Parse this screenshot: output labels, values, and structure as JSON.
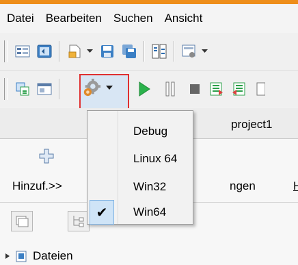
{
  "menubar": {
    "items": [
      "Datei",
      "Bearbeiten",
      "Suchen",
      "Ansicht"
    ]
  },
  "toolbar1": {
    "icons": [
      "properties-icon",
      "project-icon",
      "new-file-icon",
      "save-icon",
      "save-all-icon",
      "compare-icon",
      "options-icon"
    ]
  },
  "toolbar2": {
    "icons": [
      "copy-icon",
      "window-icon",
      "build-config-icon",
      "run-icon",
      "pause-icon",
      "stop-icon",
      "step-into-icon",
      "step-out-icon"
    ]
  },
  "tabs": {
    "project": "project1"
  },
  "panel": {
    "add_label": "Hinzuf.>>",
    "right_label": "ngen",
    "right_link": "H"
  },
  "tree": {
    "root_label": "Dateien"
  },
  "dropdown": {
    "items": [
      {
        "label": "Debug",
        "checked": false
      },
      {
        "label": "Linux 64",
        "checked": false
      },
      {
        "label": "Win32",
        "checked": false
      },
      {
        "label": "Win64",
        "checked": true
      }
    ],
    "check_glyph": "✔"
  },
  "colors": {
    "accent_top": "#ee8e1a",
    "highlight_border": "#e03030",
    "run_green": "#2bb24c",
    "selected_bg": "#cfe4f7"
  }
}
